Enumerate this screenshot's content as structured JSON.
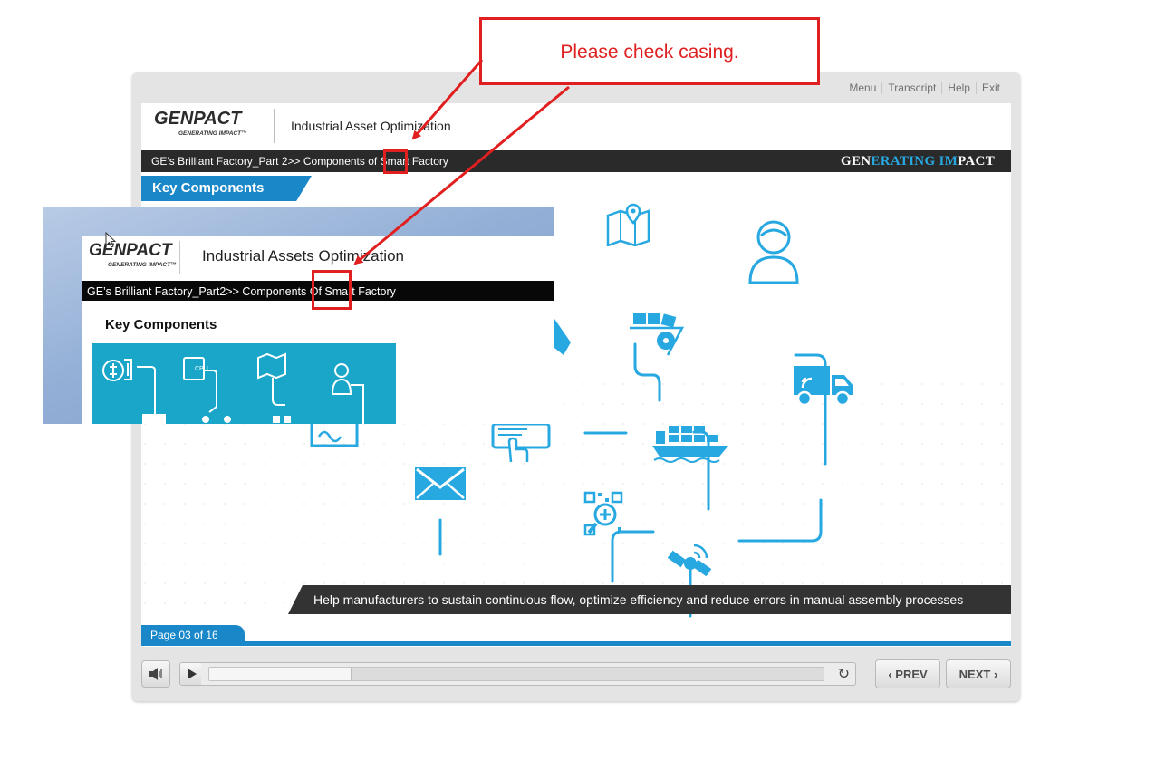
{
  "top_nav": [
    "Menu",
    "Transcript",
    "Help",
    "Exit"
  ],
  "logo": {
    "main": "GENPACT",
    "tagline": "GENERATING IMPACT™"
  },
  "course_title": "Industrial Asset Optimization",
  "breadcrumb": "GE’s Brilliant Factory_Part 2>> Components of Smart Factory",
  "brand_bar": {
    "part1": "GEN",
    "part2": "ERATING ",
    "part3": "IM",
    "part4": "PACT"
  },
  "section_tab": "Key Components",
  "caption": "Help manufacturers to sustain continuous flow, optimize efficiency and reduce errors in manual assembly processes",
  "page_indicator": "Page 03 of 16",
  "controls": {
    "prev": "PREV",
    "next": "NEXT",
    "progress_fraction": 0.23
  },
  "annotation": {
    "text": "Please check casing."
  },
  "overlay": {
    "logo_main": "GENPACT",
    "logo_tagline": "GENERATING IMPACT™",
    "title": "Industrial Assets Optimization",
    "breadcrumb": "GE’s Brilliant  Factory_Part2>> Components Of Smart Factory",
    "section": "Key Components"
  },
  "colors": {
    "accent": "#1a87c8",
    "icon": "#27a8e0",
    "annotation": "#e02020",
    "dark_bar": "#2a2a2a"
  },
  "icons": [
    "map-pin-icon",
    "user-icon",
    "conveyor-icon",
    "truck-icon",
    "ship-icon",
    "envelope-icon",
    "tablet-touch-icon",
    "qr-search-icon",
    "satellite-icon",
    "volume-icon",
    "play-icon",
    "replay-icon"
  ]
}
